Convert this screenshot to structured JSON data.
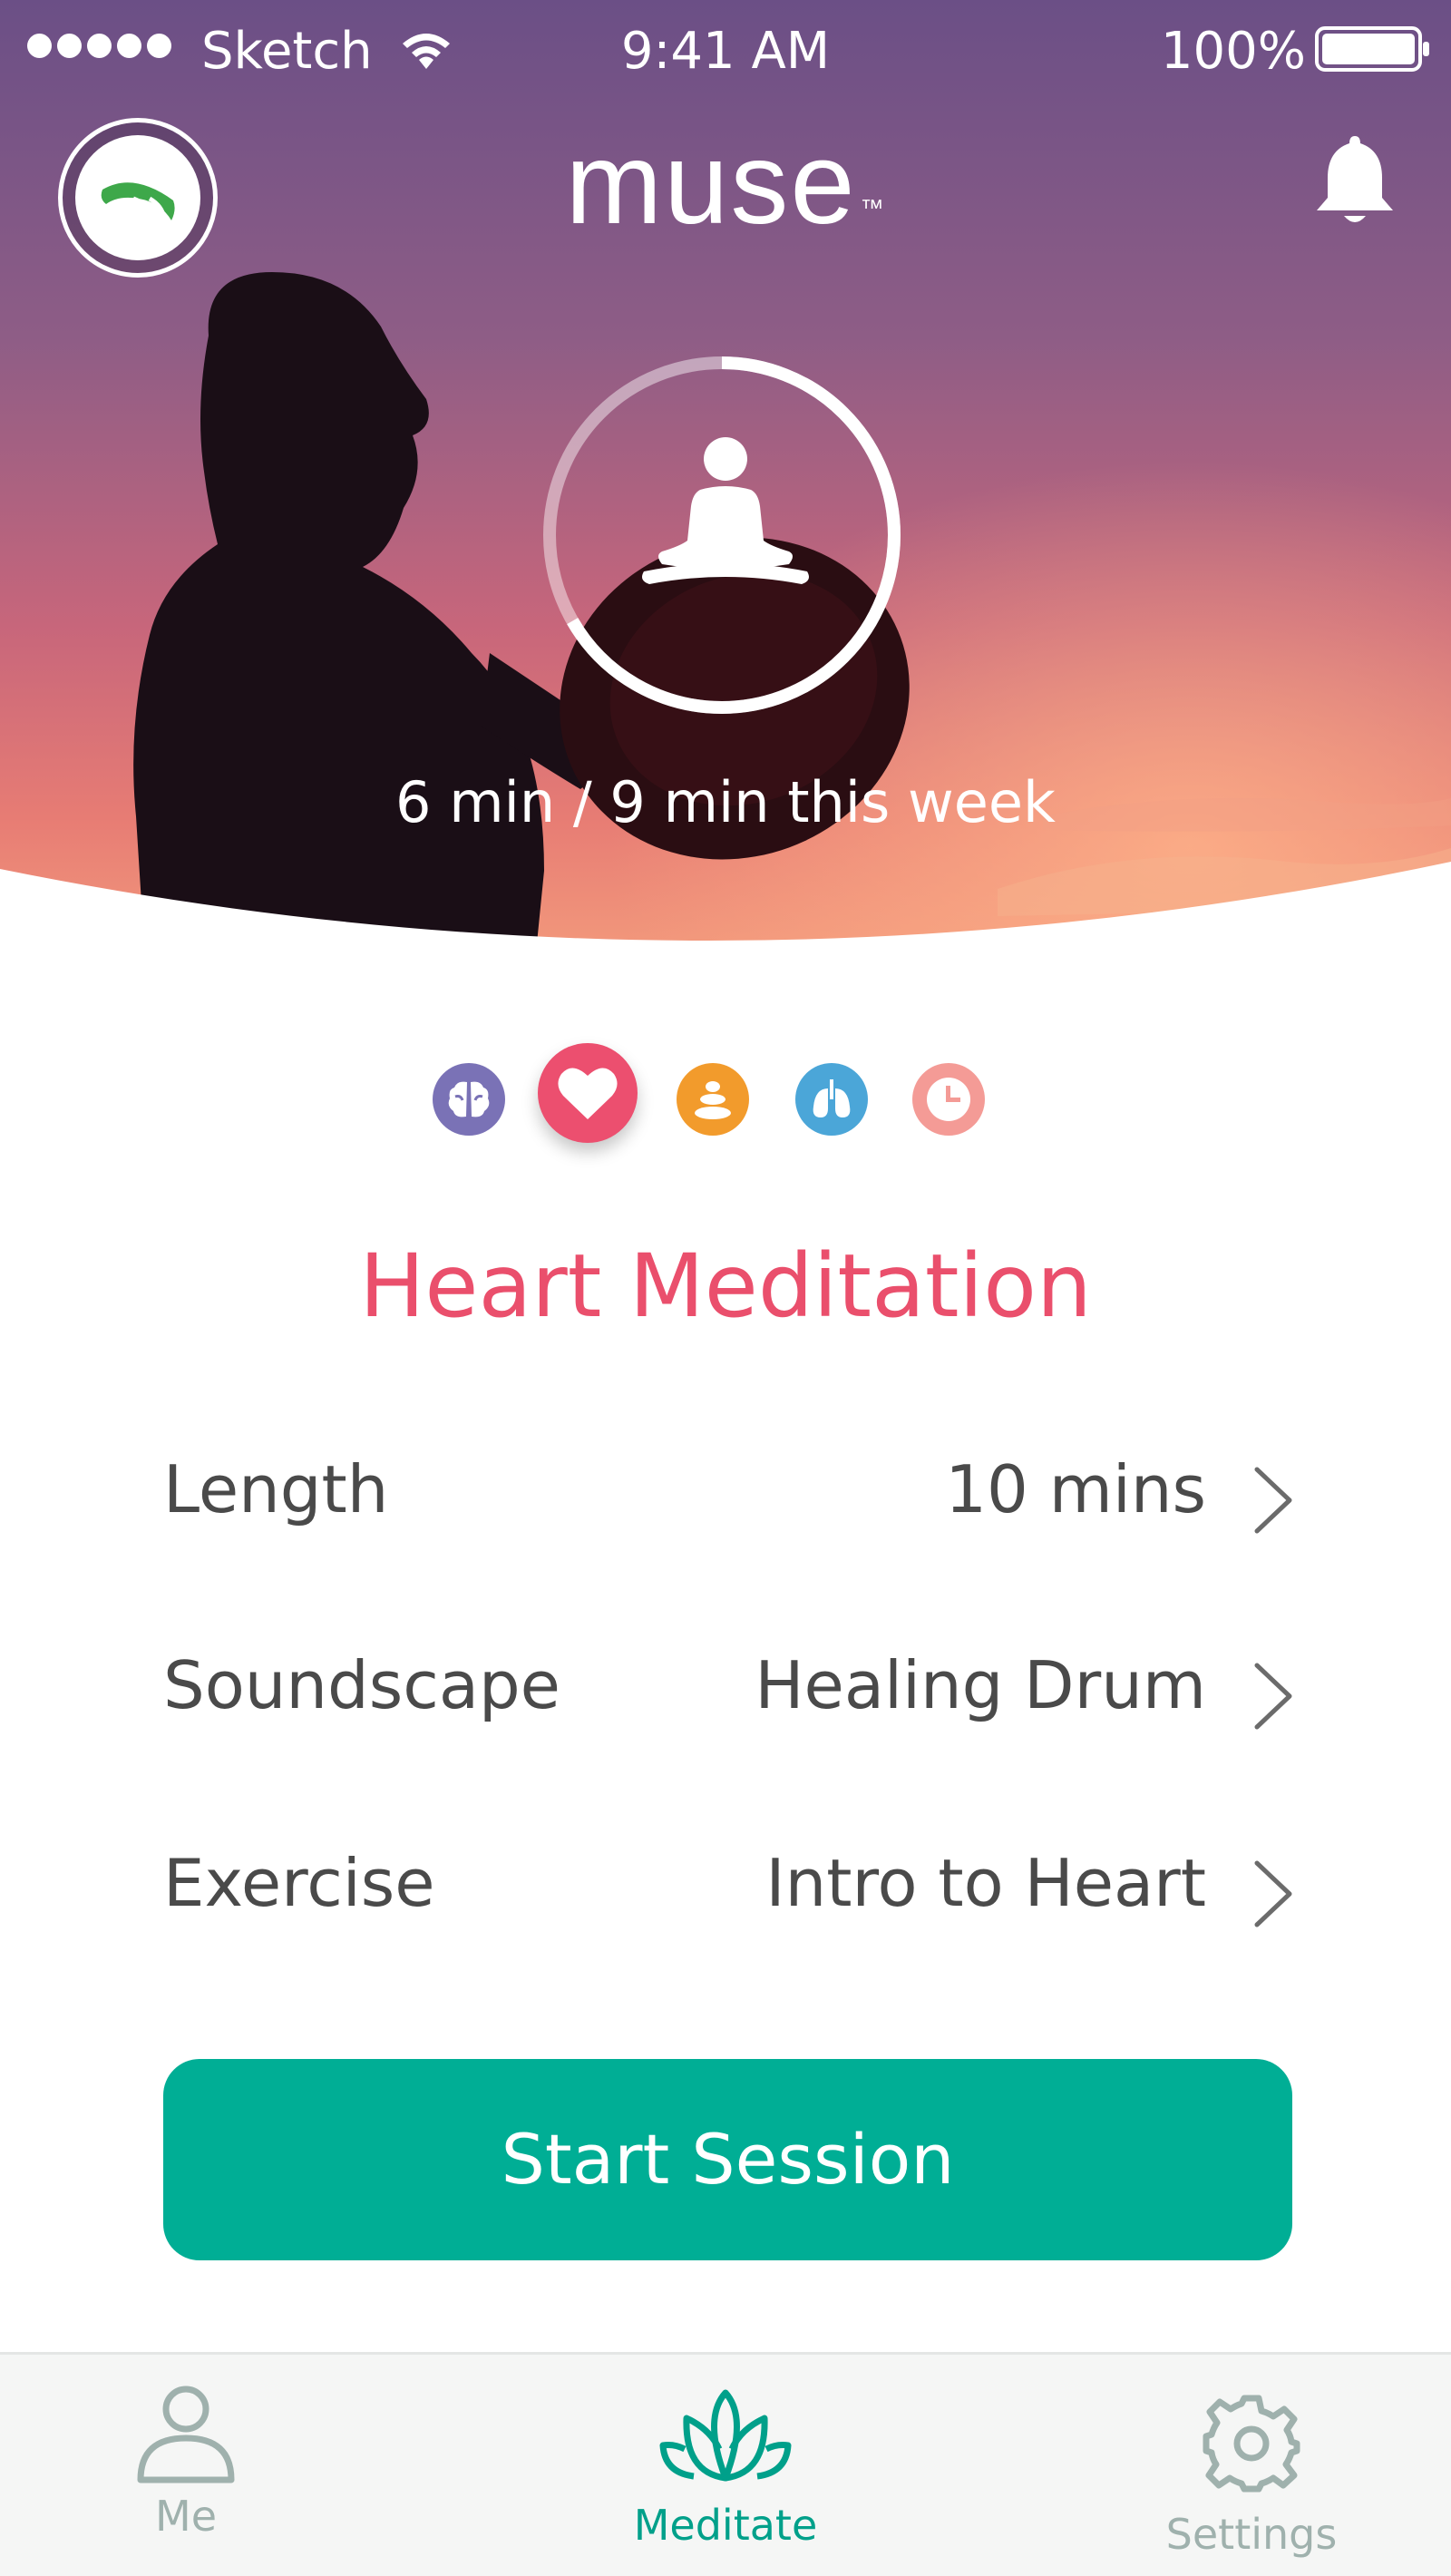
{
  "status_bar": {
    "carrier": "Sketch",
    "time": "9:41 AM",
    "battery": "100%"
  },
  "header": {
    "brand": "muse",
    "trademark": "™"
  },
  "progress": {
    "text": "6 min / 9 min this week",
    "fraction": 0.6667
  },
  "modes": [
    {
      "id": "brain",
      "icon": "brain-icon",
      "color": "#7a72b6",
      "selected": false
    },
    {
      "id": "heart",
      "icon": "heart-icon",
      "color": "#ec4f6f",
      "selected": true
    },
    {
      "id": "body",
      "icon": "stones-icon",
      "color": "#f29b2c",
      "selected": false
    },
    {
      "id": "breath",
      "icon": "lungs-icon",
      "color": "#4ba6d8",
      "selected": false
    },
    {
      "id": "timer",
      "icon": "clock-icon",
      "color": "#f49b96",
      "selected": false
    }
  ],
  "session": {
    "title": "Heart Meditation",
    "title_color": "#ea4f6c",
    "settings": [
      {
        "label": "Length",
        "value": "10 mins"
      },
      {
        "label": "Soundscape",
        "value": "Healing Drum"
      },
      {
        "label": "Exercise",
        "value": "Intro to Heart"
      }
    ],
    "start_label": "Start Session",
    "accent_color": "#00ae95"
  },
  "tabs": [
    {
      "label": "Me",
      "icon": "person-icon",
      "active": false
    },
    {
      "label": "Meditate",
      "icon": "lotus-icon",
      "active": true
    },
    {
      "label": "Settings",
      "icon": "gear-icon",
      "active": false
    }
  ]
}
